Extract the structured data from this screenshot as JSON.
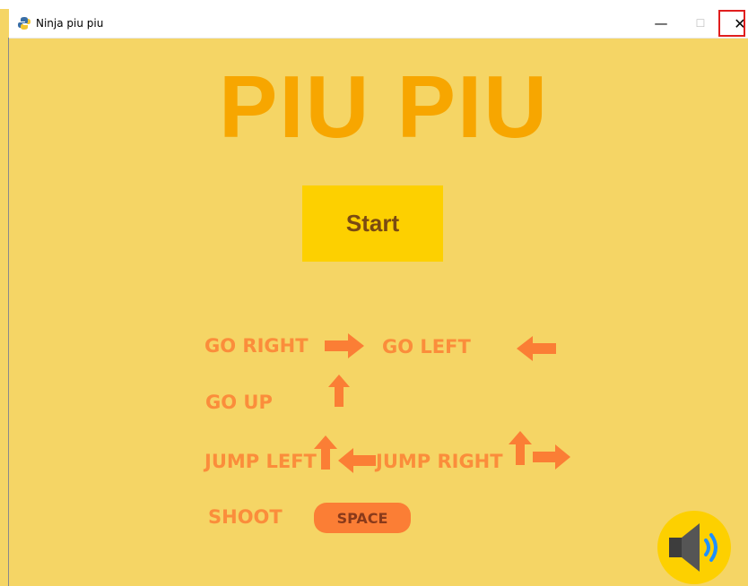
{
  "window": {
    "title": "Ninja piu piu",
    "minimize_glyph": "—",
    "maximize_glyph": "☐",
    "close_glyph": "✕"
  },
  "game": {
    "title": "PIU PIU",
    "start_label": "Start",
    "controls": {
      "go_right": "GO RIGHT",
      "go_left": "GO LEFT",
      "go_up": "GO UP",
      "jump_left": "JUMP LEFT",
      "jump_right": "JUMP RIGHT",
      "shoot": "SHOOT",
      "space_key": "SPACE"
    }
  },
  "icons": [
    "python-app-icon",
    "arrow-right-icon",
    "arrow-left-icon",
    "arrow-up-icon",
    "speaker-icon",
    "red-pointer-arrow"
  ],
  "colors": {
    "background": "#f5d565",
    "title": "#f7a600",
    "start_button": "#fdd000",
    "controls_text": "#fb8d3b",
    "arrows": "#fb7e35",
    "annotation": "#e01e1e"
  }
}
